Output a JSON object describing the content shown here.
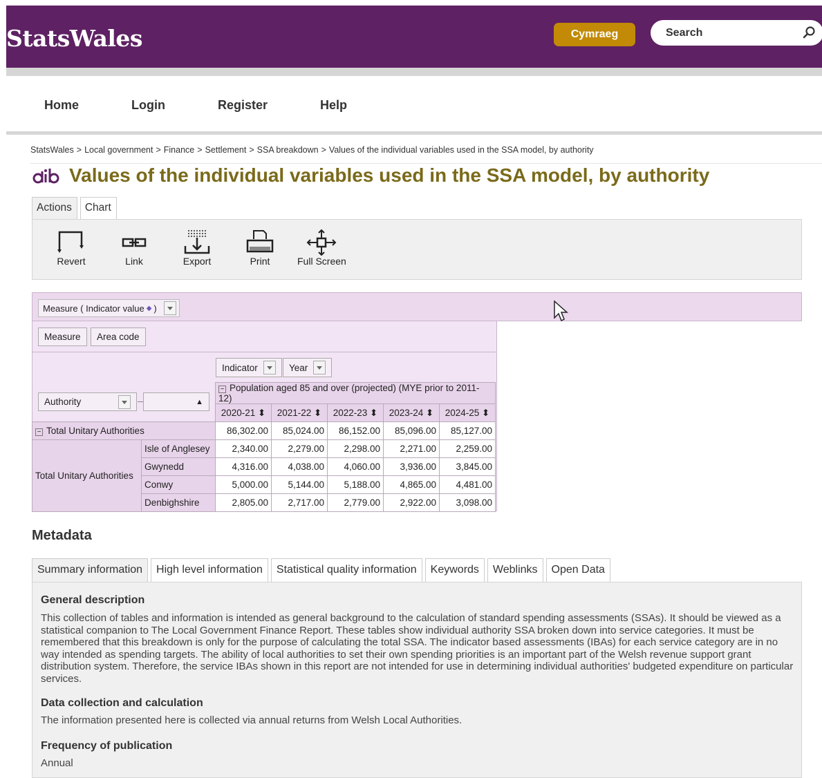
{
  "header": {
    "logo": "StatsWales",
    "language_button": "Cymraeg",
    "search_placeholder": "Search"
  },
  "nav": [
    "Home",
    "Login",
    "Register",
    "Help"
  ],
  "breadcrumb": [
    "StatsWales",
    "Local government",
    "Finance",
    "Settlement",
    "SSA breakdown",
    "Values of the individual variables used in the SSA model, by authority"
  ],
  "page_title": "Values of the individual variables used in the SSA model, by authority",
  "tabs": [
    "Actions",
    "Chart"
  ],
  "toolbar": [
    "Revert",
    "Link",
    "Export",
    "Print",
    "Full Screen"
  ],
  "pivot": {
    "measure_filter": "Measure ( Indicator value",
    "measure_filter_end": ")",
    "column_pills": [
      "Measure",
      "Area code"
    ],
    "indicator_label": "Indicator",
    "year_label": "Year",
    "authority_label": "Authority",
    "indicator_header": "Population aged 85 and over (projected) (MYE prior to 2011-12)",
    "years": [
      "2020-21",
      "2021-22",
      "2022-23",
      "2023-24",
      "2024-25"
    ],
    "total_label": "Total Unitary Authorities",
    "total_values": [
      "86,302.00",
      "85,024.00",
      "86,152.00",
      "85,096.00",
      "85,127.00"
    ],
    "group_label": "Total Unitary Authorities",
    "rows": [
      {
        "name": "Isle of Anglesey",
        "values": [
          "2,340.00",
          "2,279.00",
          "2,298.00",
          "2,271.00",
          "2,259.00"
        ]
      },
      {
        "name": "Gwynedd",
        "values": [
          "4,316.00",
          "4,038.00",
          "4,060.00",
          "3,936.00",
          "3,845.00"
        ]
      },
      {
        "name": "Conwy",
        "values": [
          "5,000.00",
          "5,144.00",
          "5,188.00",
          "4,865.00",
          "4,481.00"
        ]
      },
      {
        "name": "Denbighshire",
        "values": [
          "2,805.00",
          "2,717.00",
          "2,779.00",
          "2,922.00",
          "3,098.00"
        ]
      }
    ]
  },
  "metadata": {
    "title": "Metadata",
    "tabs": [
      "Summary information",
      "High level information",
      "Statistical quality information",
      "Keywords",
      "Weblinks",
      "Open Data"
    ],
    "general_heading": "General description",
    "general_text": "This collection of tables and information is intended as general background to the calculation of standard spending assessments (SSAs). It should be viewed as a statistical companion to The Local Government Finance Report. These tables show individual authority SSA broken down into service categories. It must be remembered that this breakdown is only for the purpose of calculating the total SSA. The indicator based assessments (IBAs) for each service category are in no way intended as spending targets. The ability of local authorities to set their own spending priorities is an important part of the Welsh revenue support grant distribution system. Therefore, the service IBAs shown in this report are not intended for use in determining individual authorities' budgeted expenditure on particular services.",
    "collection_heading": "Data collection and calculation",
    "collection_text": "The information presented here is collected via annual returns from Welsh Local Authorities.",
    "frequency_heading": "Frequency of publication",
    "frequency_text": "Annual"
  },
  "colors": {
    "header_purple": "#5e2163",
    "cymraeg_gold": "#c28a07",
    "title_olive": "#7a6a1a",
    "pivot_lilac": "#ecd9ee"
  }
}
